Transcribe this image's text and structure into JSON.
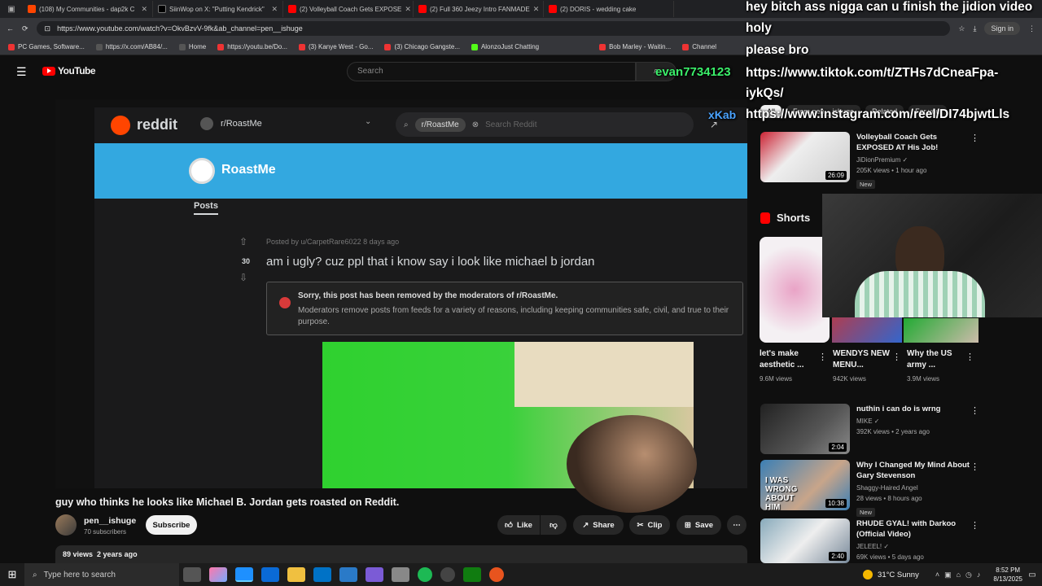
{
  "browser": {
    "tabs": [
      {
        "label": "(108) My Communities - dap2k C",
        "color": "#ff4500"
      },
      {
        "label": "SiinWop on X: \"Putting Kendrick\"",
        "color": "#000000"
      },
      {
        "label": "(2) Volleyball Coach Gets EXPOSE",
        "color": "#ff0000"
      },
      {
        "label": "(2) Full 360 Jeezy Intro FANMADE",
        "color": "#ff0000"
      },
      {
        "label": "(2) DORIS - wedding cake",
        "color": "#ff0000"
      }
    ],
    "url": "https://www.youtube.com/watch?v=OkvBzvV-9fk&ab_channel=pen__ishuge",
    "sign_in": "Sign in",
    "bookmarks": [
      "PC Games, Software...",
      "https://x.com/AB84/...",
      "Home",
      "https://youtu.be/Do...",
      "(3) Kanye West - Go...",
      "(3) Chicago Gangste...",
      "AlonzoJust Chatting",
      "Bob Marley - Waitin...",
      "Channel"
    ]
  },
  "youtube": {
    "logo": "YouTube",
    "search_placeholder": "Search"
  },
  "video": {
    "reddit_logo": "reddit",
    "subreddit": "r/RoastMe",
    "search_chip": "r/RoastMe",
    "search_placeholder": "Search Reddit",
    "banner_name": "RoastMe",
    "posts_tab": "Posts",
    "posted_by": "Posted by u/CarpetRare6022 8 days ago",
    "votes": "30",
    "post_title": "am i ugly? cuz ppl that i know say i look like michael b jordan",
    "removed_title": "Sorry, this post has been removed by the moderators of r/RoastMe.",
    "removed_body": "Moderators remove posts from feeds for a variety of reasons, including keeping communities safe, civil, and true to their purpose.",
    "title": "guy who thinks he looks like Michael B. Jordan gets roasted on Reddit.",
    "channel": "pen__ishuge",
    "subscribers": "70 subscribers",
    "subscribe": "Subscribe",
    "like": "Like",
    "share": "Share",
    "clip": "Clip",
    "save": "Save",
    "views": "89 views",
    "age": "2 years ago"
  },
  "sidebar": {
    "chips": [
      "All",
      "From pen__ishuge",
      "Related",
      "For you"
    ],
    "top_video": {
      "title": "Volleyball Coach Gets EXPOSED AT His Job!",
      "channel": "JiDionPremium",
      "meta": "205K views • 1 hour ago",
      "badge": "New",
      "duration": "26:09"
    },
    "shorts_label": "Shorts",
    "shorts": [
      {
        "title": "let's make aesthetic ...",
        "views": "9.6M views"
      },
      {
        "title": "WENDYS NEW MENU...",
        "views": "942K views"
      },
      {
        "title": "Why the US army ...",
        "views": "3.9M views"
      }
    ],
    "videos": [
      {
        "title": "nuthin i can do is wrng",
        "channel": "MIKE",
        "meta": "392K views • 2 years ago",
        "duration": "2:04",
        "badge": ""
      },
      {
        "title": "Why I Changed My Mind About Gary Stevenson",
        "channel": "Shaggy-Haired Angel",
        "meta": "28 views • 8 hours ago",
        "duration": "10:38",
        "badge": "New"
      },
      {
        "title": "RHUDE GYAL! with Darkoo (Official Video)",
        "channel": "JELEEL!",
        "meta": "69K views • 5 days ago",
        "duration": "2:40",
        "badge": ""
      }
    ]
  },
  "overlay": {
    "chat_line1": "hey bitch ass nigga can u finish the jidion video",
    "chat_line2": "holy",
    "chat_line3": "please bro",
    "chat_line4": "https://www.tiktok.com/t/ZTHs7dCneaFpa-",
    "chat_line5": "iykQs/",
    "chat_line6": "https://www.instagram.com/reel/DI74bjwtLls",
    "username": "evan7734123",
    "username2": "xKab",
    "thumb_text": "I WAS WRONG ABOUT HIM"
  },
  "taskbar": {
    "search": "Type here to search",
    "weather": "31°C Sunny",
    "time": "8:52 PM",
    "date": "8/13/2025"
  }
}
